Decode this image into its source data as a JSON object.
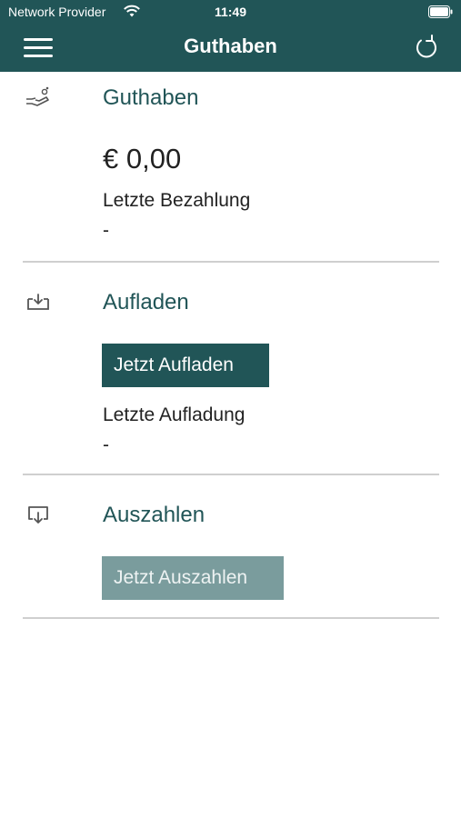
{
  "status_bar": {
    "carrier": "Network Provider",
    "time": "11:49"
  },
  "nav": {
    "title": "Guthaben",
    "menu_icon": "hamburger-menu-icon",
    "refresh_icon": "refresh-icon"
  },
  "balance": {
    "title": "Guthaben",
    "icon": "hand-coin-icon",
    "amount": "€ 0,00",
    "last_payment_label": "Letzte Bezahlung",
    "last_payment_value": "-"
  },
  "topup": {
    "title": "Aufladen",
    "icon": "tray-download-icon",
    "button_label": "Jetzt Aufladen",
    "last_topup_label": "Letzte Aufladung",
    "last_topup_value": "-"
  },
  "payout": {
    "title": "Auszahlen",
    "icon": "screen-download-icon",
    "button_label": "Jetzt Auszahlen"
  },
  "colors": {
    "brand": "#215557",
    "disabled_button": "#7a9c9d",
    "divider": "#cfcfcf"
  }
}
